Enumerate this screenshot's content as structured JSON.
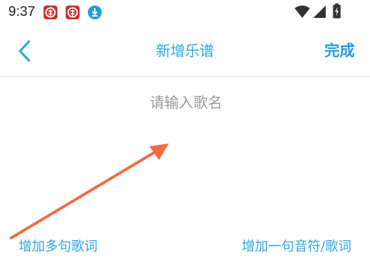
{
  "status_bar": {
    "time": "9:37",
    "notification_icons": [
      "app-notification-icon",
      "app-notification-icon",
      "download-icon"
    ],
    "system_icons": [
      "wifi-icon",
      "signal-icon",
      "battery-charging-icon"
    ]
  },
  "header": {
    "back_icon": "chevron-left-icon",
    "title": "新增乐谱",
    "done_label": "完成"
  },
  "song_name": {
    "value": "",
    "placeholder": "请输入歌名"
  },
  "actions": {
    "add_lyrics_label": "增加多句歌词",
    "add_note_lyrics_label": "增加一句音符/歌词"
  },
  "colors": {
    "accent": "#2aa7e6",
    "annotation_arrow": "#f26b43",
    "notification_red": "#d62c2c"
  }
}
